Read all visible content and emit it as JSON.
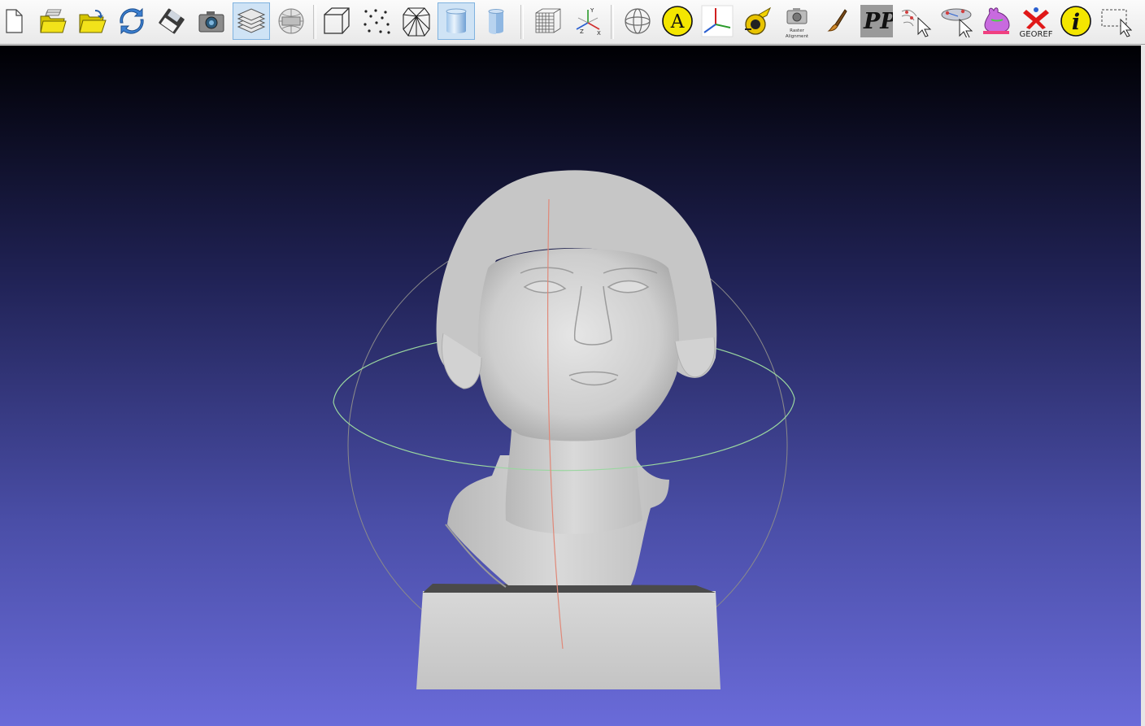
{
  "toolbar": {
    "raster_alignment_label": "Raster Alignment",
    "annotation_letter": "A",
    "georef_label": "GEOREF",
    "pp_label": "PP",
    "info_letter": "i",
    "axis_labels": {
      "y": "Y",
      "z": "Z",
      "x": "X"
    }
  },
  "viewport": {
    "background_top": "#000003",
    "background_bottom": "#6a6bd9",
    "mesh_color": "#cfcfcf",
    "trackball_colors": {
      "horizontal": "#9ad6a0",
      "vertical": "#e08878",
      "outer": "#8a8a8a"
    }
  }
}
